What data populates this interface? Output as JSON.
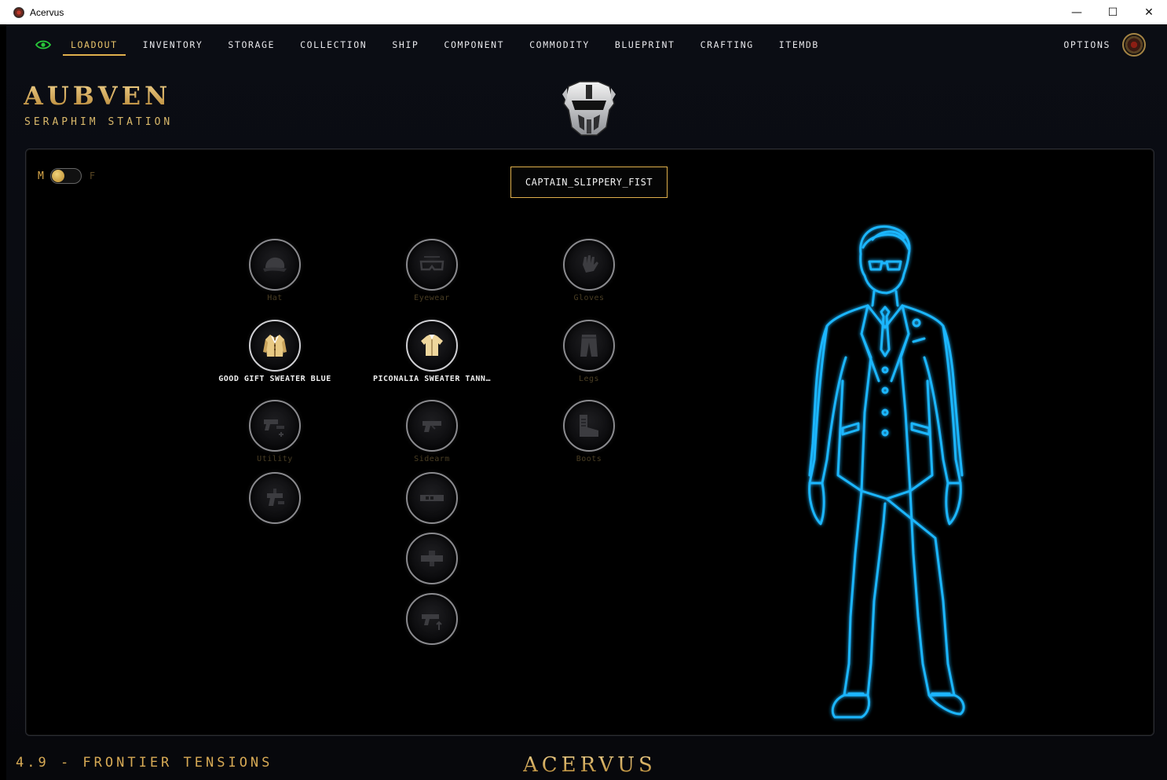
{
  "window": {
    "title": "Acervus",
    "controls": {
      "minimize": "—",
      "maximize": "☐",
      "close": "✕"
    }
  },
  "nav": {
    "items": [
      {
        "label": "LOADOUT",
        "active": true
      },
      {
        "label": "INVENTORY"
      },
      {
        "label": "STORAGE"
      },
      {
        "label": "COLLECTION"
      },
      {
        "label": "SHIP"
      },
      {
        "label": "COMPONENT"
      },
      {
        "label": "COMMODITY"
      },
      {
        "label": "BLUEPRINT"
      },
      {
        "label": "CRAFTING"
      },
      {
        "label": "ITEMDB"
      }
    ],
    "options_label": "OPTIONS",
    "eye_icon": "eye-icon",
    "eye_color": "#29c93a"
  },
  "header": {
    "location": "AUBVEN",
    "station": "SERAPHIM STATION"
  },
  "panel": {
    "gender_toggle": {
      "left": "M",
      "right": "F",
      "selected": "M"
    },
    "player_name": "CAPTAIN_SLIPPERY_FIST",
    "slots": {
      "hat": "Hat",
      "eyewear": "Eyewear",
      "gloves": "Gloves",
      "torso": "GOOD GIFT SWEATER BLUE",
      "undershirt": "PICONALIA SWEATER TANNE…",
      "legs": "Legs",
      "utility": "Utility",
      "sidearm": "Sidearm",
      "boots": "Boots"
    }
  },
  "footer": {
    "version": "4.9 - FRONTIER TENSIONS",
    "brand": "ACERVUS"
  },
  "colors": {
    "accent_gold": "#e0b04c",
    "figure_cyan": "#1ab6ff",
    "background": "#000000"
  }
}
